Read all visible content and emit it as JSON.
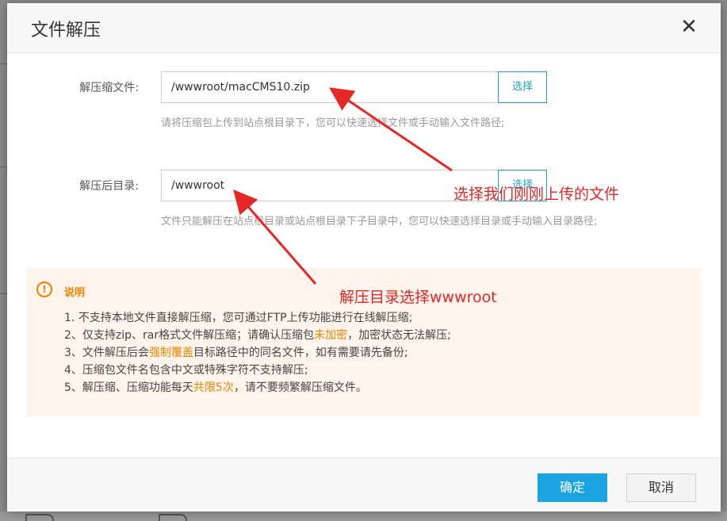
{
  "dialog": {
    "title": "文件解压",
    "close_symbol": "✕"
  },
  "form": {
    "source_label": "解压缩文件:",
    "source_value": "/wwwroot/macCMS10.zip",
    "source_select": "选择",
    "source_hint": "请将压缩包上传到站点根目录下，您可以快速选择文件或手动输入文件路径;",
    "target_label": "解压后目录:",
    "target_value": "/wwwroot",
    "target_select": "选择",
    "target_hint": "文件只能解压在站点根目录或站点根目录下子目录中，您可以快速选择目录或手动输入目录路径;"
  },
  "notice": {
    "icon_symbol": "!",
    "title": "说明",
    "line1": "1. 不支持本地文件直接解压缩，您可通过FTP上传功能进行在线解压缩;",
    "line2_a": "2、仅支持zip、rar格式文件解压缩；请确认压缩包",
    "line2_hl": "未加密",
    "line2_b": "，加密状态无法解压;",
    "line3_a": "3、文件解压后会",
    "line3_hl": "强制覆盖",
    "line3_b": "目标路径中的同名文件，如有需要请先备份;",
    "line4": "4、压缩包文件名包含中文或特殊字符不支持解压;",
    "line5_a": "5、解压缩、压缩功能每天",
    "line5_hl": "共限5次",
    "line5_b": "，请不要频繁解压缩文件。"
  },
  "footer": {
    "confirm": "确定",
    "cancel": "取消"
  },
  "annotations": {
    "upload_note": "选择我们刚刚上传的文件",
    "dir_note": "解压目录选择wwwroot"
  },
  "icons": {
    "close": "close-icon",
    "notice": "alert-circle-icon"
  },
  "colors": {
    "accent": "#1aa3e0",
    "select_border": "#20a0c0",
    "warning": "#f08200",
    "notice_bg": "#fff4ec",
    "annotation": "#e52727"
  }
}
